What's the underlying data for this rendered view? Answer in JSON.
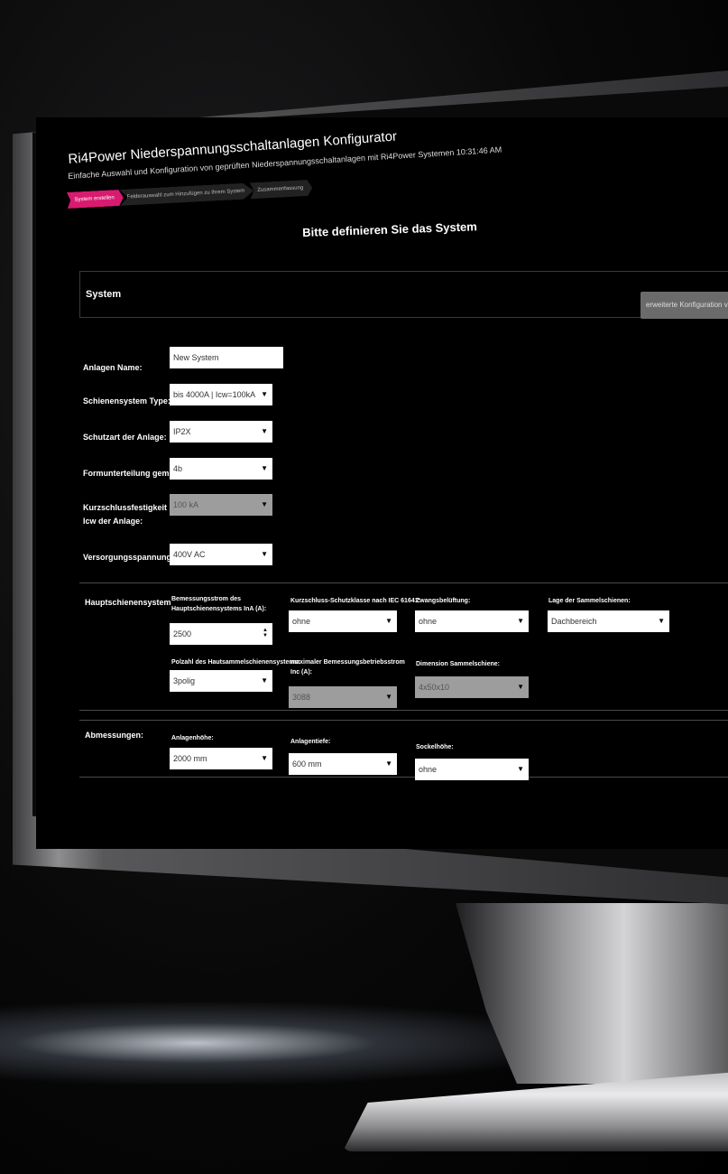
{
  "app": {
    "title": "Ri4Power Niederspannungsschaltanlagen Konfigurator",
    "subtitle": "Einfache Auswahl und Konfiguration von geprüften Niederspannungsschaltanlagen mit Ri4Power Systemen 10:31:46 AM"
  },
  "steps": [
    {
      "label": "System erstellen",
      "active": true
    },
    {
      "label": "Felderauswahl zum Hinzufügen zu Ihrem System",
      "active": false
    },
    {
      "label": "Zusammenfassung",
      "active": false
    }
  ],
  "page": {
    "heading": "Bitte definieren Sie das System"
  },
  "system": {
    "section_label": "System",
    "advanced_button": "erweiterte Konfiguration v",
    "fields": {
      "anlagen_name": {
        "label": "Anlagen Name:",
        "value": "New System"
      },
      "schienensystem": {
        "label": "Schienensystem Type:",
        "value": "bis 4000A | Icw=100kA"
      },
      "schutzart": {
        "label": "Schutzart der Anlage:",
        "value": "IP2X"
      },
      "formunterteilung": {
        "label": "Formunterteilung gem. IEC:",
        "value": "4b"
      },
      "kurzschluss": {
        "label": "Kurzschlussfestigkeit Icw der Anlage:",
        "value": "100 kA"
      },
      "versorgung": {
        "label": "Versorgungsspannung:",
        "value": "400V AC"
      }
    }
  },
  "hauptschienen": {
    "section_label": "Hauptschienensystem",
    "bemessungsstrom": {
      "label": "Bemessungsstrom des Hauptschienensystems InA (A):",
      "value": "2500"
    },
    "kurzschlussklasse": {
      "label": "Kurzschluss-Schutzklasse nach IEC 61641:",
      "value": "ohne"
    },
    "zwangsbelueftung": {
      "label": "Zwangsbelüftung:",
      "value": "ohne"
    },
    "lage": {
      "label": "Lage der Sammelschienen:",
      "value": "Dachbereich"
    },
    "polzahl": {
      "label": "Polzahl des Hautsammelschienensystems:",
      "value": "3polig"
    },
    "max_strom": {
      "label": "maximaler Bemessungsbetriebsstrom Inc (A):",
      "value": "3088"
    },
    "dimension": {
      "label": "Dimension Sammelschiene:",
      "value": "4x50x10"
    }
  },
  "abmessungen": {
    "section_label": "Abmessungen:",
    "hoehe": {
      "label": "Anlagenhöhe:",
      "value": "2000 mm"
    },
    "tiefe": {
      "label": "Anlagentiefe:",
      "value": "600 mm"
    },
    "sockel": {
      "label": "Sockelhöhe:",
      "value": "ohne"
    }
  },
  "icons": {
    "dropdown": "chevron-down-icon",
    "spinner": "stepper-icon"
  }
}
